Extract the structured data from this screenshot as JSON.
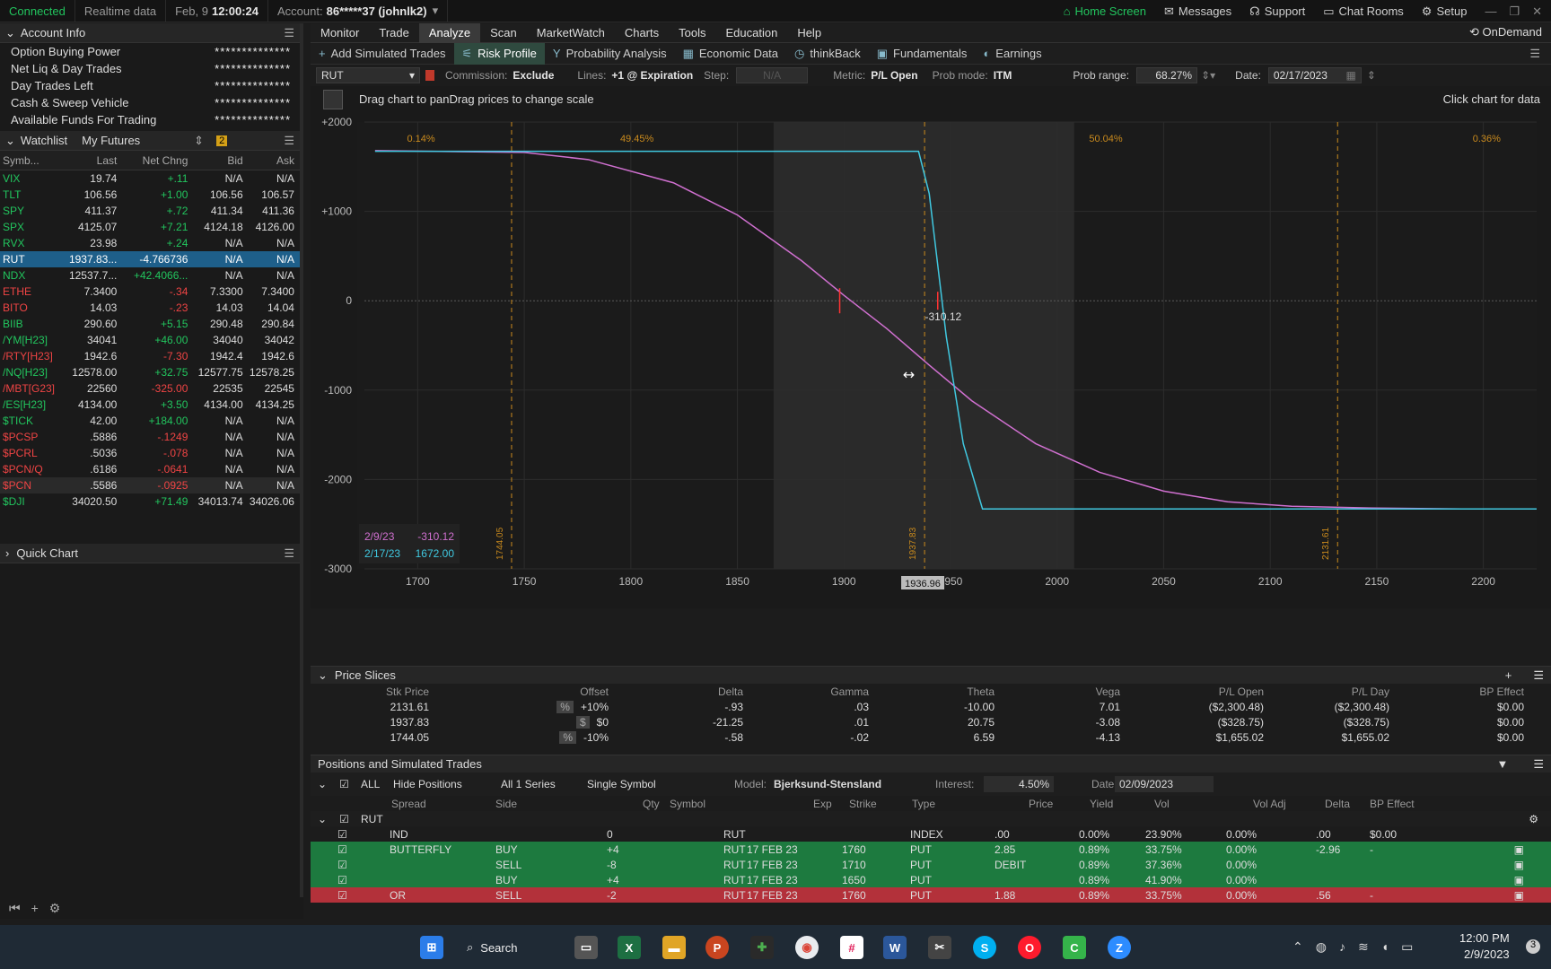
{
  "topbar": {
    "connected": "Connected",
    "realtime": "Realtime data",
    "date": "Feb, 9",
    "time": "12:00:24",
    "account_label": "Account:",
    "account_value": "86*****37 (johnlk2)",
    "home": "Home Screen",
    "messages": "Messages",
    "support": "Support",
    "chat": "Chat Rooms",
    "setup": "Setup"
  },
  "left": {
    "account_info": "Account Info",
    "account_rows": [
      {
        "label": "Option Buying Power",
        "value": "**************"
      },
      {
        "label": "Net Liq & Day Trades",
        "value": "**************"
      },
      {
        "label": "Day Trades Left",
        "value": "**************"
      },
      {
        "label": "Cash & Sweep Vehicle",
        "value": "**************"
      },
      {
        "label": "Available Funds For Trading",
        "value": "**************"
      }
    ],
    "watchlist_title": "Watchlist",
    "watchlist_name": "My Futures",
    "watchlist_badge": "2",
    "wl_cols": [
      "Symb...",
      "Last",
      "Net Chng",
      "Bid",
      "Ask"
    ],
    "wl": [
      {
        "sym": "VIX",
        "last": "19.74",
        "chg": "+.11",
        "bid": "N/A",
        "ask": "N/A",
        "c": "pos"
      },
      {
        "sym": "TLT",
        "last": "106.56",
        "chg": "+1.00",
        "bid": "106.56",
        "ask": "106.57",
        "c": "pos"
      },
      {
        "sym": "SPY",
        "last": "411.37",
        "chg": "+.72",
        "bid": "411.34",
        "ask": "411.36",
        "c": "pos"
      },
      {
        "sym": "SPX",
        "last": "4125.07",
        "chg": "+7.21",
        "bid": "4124.18",
        "ask": "4126.00",
        "c": "pos"
      },
      {
        "sym": "RVX",
        "last": "23.98",
        "chg": "+.24",
        "bid": "N/A",
        "ask": "N/A",
        "c": "pos"
      },
      {
        "sym": "RUT",
        "last": "1937.83...",
        "chg": "-4.766736",
        "bid": "N/A",
        "ask": "N/A",
        "c": "sel"
      },
      {
        "sym": "NDX",
        "last": "12537.7...",
        "chg": "+42.4066...",
        "bid": "N/A",
        "ask": "N/A",
        "c": "pos"
      },
      {
        "sym": "ETHE",
        "last": "7.3400",
        "chg": "-.34",
        "bid": "7.3300",
        "ask": "7.3400",
        "c": "neg"
      },
      {
        "sym": "BITO",
        "last": "14.03",
        "chg": "-.23",
        "bid": "14.03",
        "ask": "14.04",
        "c": "neg"
      },
      {
        "sym": "BIIB",
        "last": "290.60",
        "chg": "+5.15",
        "bid": "290.48",
        "ask": "290.84",
        "c": "pos"
      },
      {
        "sym": "/YM[H23]",
        "last": "34041",
        "chg": "+46.00",
        "bid": "34040",
        "ask": "34042",
        "c": "pos"
      },
      {
        "sym": "/RTY[H23]",
        "last": "1942.6",
        "chg": "-7.30",
        "bid": "1942.4",
        "ask": "1942.6",
        "c": "neg"
      },
      {
        "sym": "/NQ[H23]",
        "last": "12578.00",
        "chg": "+32.75",
        "bid": "12577.75",
        "ask": "12578.25",
        "c": "pos"
      },
      {
        "sym": "/MBT[G23]",
        "last": "22560",
        "chg": "-325.00",
        "bid": "22535",
        "ask": "22545",
        "c": "neg"
      },
      {
        "sym": "/ES[H23]",
        "last": "4134.00",
        "chg": "+3.50",
        "bid": "4134.00",
        "ask": "4134.25",
        "c": "pos"
      },
      {
        "sym": "$TICK",
        "last": "42.00",
        "chg": "+184.00",
        "bid": "N/A",
        "ask": "N/A",
        "c": "pos"
      },
      {
        "sym": "$PCSP",
        "last": ".5886",
        "chg": "-.1249",
        "bid": "N/A",
        "ask": "N/A",
        "c": "neg"
      },
      {
        "sym": "$PCRL",
        "last": ".5036",
        "chg": "-.078",
        "bid": "N/A",
        "ask": "N/A",
        "c": "neg"
      },
      {
        "sym": "$PCN/Q",
        "last": ".6186",
        "chg": "-.0641",
        "bid": "N/A",
        "ask": "N/A",
        "c": "neg"
      },
      {
        "sym": "$PCN",
        "last": ".5586",
        "chg": "-.0925",
        "bid": "N/A",
        "ask": "N/A",
        "c": "neg"
      },
      {
        "sym": "$DJI",
        "last": "34020.50",
        "chg": "+71.49",
        "bid": "34013.74",
        "ask": "34026.06",
        "c": "pos"
      }
    ],
    "quick_chart": "Quick Chart"
  },
  "tabs": [
    "Monitor",
    "Trade",
    "Analyze",
    "Scan",
    "MarketWatch",
    "Charts",
    "Tools",
    "Education",
    "Help"
  ],
  "ondemand": "OnDemand",
  "subtabs": [
    "Add Simulated Trades",
    "Risk Profile",
    "Probability Analysis",
    "Economic Data",
    "thinkBack",
    "Fundamentals",
    "Earnings"
  ],
  "ctrl": {
    "symbol": "RUT",
    "commission_label": "Commission:",
    "commission": "Exclude",
    "lines_label": "Lines:",
    "lines": "+1 @ Expiration",
    "step_label": "Step:",
    "step": "N/A",
    "metric_label": "Metric:",
    "metric": "P/L Open",
    "prob_label": "Prob mode:",
    "prob": "ITM",
    "range_label": "Prob range:",
    "range": "68.27%",
    "date_label": "Date:",
    "date": "02/17/2023"
  },
  "chart_hint": "Drag chart to panDrag prices to change scale",
  "click_hint": "Click chart for data",
  "chart_data": {
    "type": "line",
    "ylabels": [
      "+2000",
      "+1000",
      "0",
      "-1000",
      "-2000",
      "-3000"
    ],
    "yvals": [
      2000,
      1000,
      0,
      -1000,
      -2000,
      -3000
    ],
    "xlabels": [
      "1700",
      "1750",
      "1800",
      "1850",
      "1900",
      "1950",
      "2000",
      "2050",
      "2100",
      "2150",
      "2200"
    ],
    "xvals": [
      1700,
      1750,
      1800,
      1850,
      1900,
      1950,
      2000,
      2050,
      2100,
      2150,
      2200
    ],
    "xlim": [
      1675,
      2225
    ],
    "ylim": [
      -3000,
      2000
    ],
    "prob_labels": [
      "0.14%",
      "49.45%",
      "50.04%",
      "0.36%"
    ],
    "vlines": [
      {
        "x": 1744.05,
        "label": "1744.05"
      },
      {
        "x": 1937.83,
        "label": "1937.83"
      },
      {
        "x": 2131.61,
        "label": "2131.61"
      }
    ],
    "price_marker": "1936.96",
    "point_label": "-310.12",
    "legend": [
      {
        "date": "2/9/23",
        "value": "-310.12",
        "color": "#d070d0"
      },
      {
        "date": "2/17/23",
        "value": "1672.00",
        "color": "#40c8e0"
      }
    ],
    "series": [
      {
        "color": "#d070d0",
        "x": [
          1680,
          1750,
          1780,
          1820,
          1850,
          1880,
          1900,
          1920,
          1940,
          1960,
          1990,
          2020,
          2050,
          2080,
          2110,
          2150,
          2190
        ],
        "y": [
          1680,
          1660,
          1580,
          1320,
          960,
          450,
          60,
          -310,
          -720,
          -1120,
          -1600,
          -1920,
          -2130,
          -2250,
          -2300,
          -2320,
          -2330
        ]
      },
      {
        "color": "#40c8e0",
        "x": [
          1680,
          1935,
          1940,
          1948,
          1956,
          1965,
          2225
        ],
        "y": [
          1672,
          1672,
          1200,
          -400,
          -1600,
          -2330,
          -2330
        ]
      }
    ]
  },
  "price_slices": {
    "title": "Price Slices",
    "cols": [
      "Stk Price",
      "Offset",
      "Delta",
      "Gamma",
      "Theta",
      "Vega",
      "P/L Open",
      "P/L Day",
      "BP Effect"
    ],
    "rows": [
      {
        "stk": "2131.61",
        "unit": "%",
        "off": "+10%",
        "delta": "-.93",
        "gamma": ".03",
        "theta": "-10.00",
        "vega": "7.01",
        "plo": "($2,300.48)",
        "pld": "($2,300.48)",
        "bp": "$0.00"
      },
      {
        "stk": "1937.83",
        "unit": "$",
        "off": "$0",
        "delta": "-21.25",
        "gamma": ".01",
        "theta": "20.75",
        "vega": "-3.08",
        "plo": "($328.75)",
        "pld": "($328.75)",
        "bp": "$0.00"
      },
      {
        "stk": "1744.05",
        "unit": "%",
        "off": "-10%",
        "delta": "-.58",
        "gamma": "-.02",
        "theta": "6.59",
        "vega": "-4.13",
        "plo": "$1,655.02",
        "pld": "$1,655.02",
        "bp": "$0.00"
      }
    ]
  },
  "positions": {
    "title": "Positions and Simulated Trades",
    "all": "ALL",
    "hide": "Hide Positions",
    "series": "All 1 Series",
    "single": "Single Symbol",
    "model_label": "Model:",
    "model": "Bjerksund-Stensland",
    "interest_label": "Interest:",
    "interest": "4.50%",
    "date_label": "Date:",
    "date": "02/09/2023",
    "cols": [
      "Spread",
      "Side",
      "Qty",
      "Symbol",
      "Exp",
      "Strike",
      "Type",
      "Price",
      "Yield",
      "Vol",
      "Vol Adj",
      "Delta",
      "BP Effect"
    ],
    "group": "RUT",
    "rows": [
      {
        "spread": "IND",
        "side": "",
        "qty": "0",
        "sym": "RUT",
        "exp": "",
        "strike": "",
        "type": "INDEX",
        "price": ".00",
        "yield": "0.00%",
        "vol": "23.90%",
        "voladj": "0.00%",
        "delta": ".00",
        "bp": "$0.00",
        "cls": ""
      },
      {
        "spread": "BUTTERFLY",
        "side": "BUY",
        "qty": "+4",
        "sym": "RUT",
        "exp": "17 FEB 23",
        "strike": "1760",
        "type": "PUT",
        "price": "2.85",
        "yield": "0.89%",
        "vol": "33.75%",
        "voladj": "0.00%",
        "delta": "-2.96",
        "bp": "-",
        "cls": "g"
      },
      {
        "spread": "",
        "side": "SELL",
        "qty": "-8",
        "sym": "RUT",
        "exp": "17 FEB 23",
        "strike": "1710",
        "type": "PUT",
        "price": "DEBIT",
        "yield": "0.89%",
        "vol": "37.36%",
        "voladj": "0.00%",
        "delta": "",
        "bp": "",
        "cls": "g"
      },
      {
        "spread": "",
        "side": "BUY",
        "qty": "+4",
        "sym": "RUT",
        "exp": "17 FEB 23",
        "strike": "1650",
        "type": "PUT",
        "price": "",
        "yield": "0.89%",
        "vol": "41.90%",
        "voladj": "0.00%",
        "delta": "",
        "bp": "",
        "cls": "g"
      },
      {
        "spread": "OR",
        "side": "SELL",
        "qty": "-2",
        "sym": "RUT",
        "exp": "17 FEB 23",
        "strike": "1760",
        "type": "PUT",
        "price": "1.88",
        "yield": "0.89%",
        "vol": "33.75%",
        "voladj": "0.00%",
        "delta": ".56",
        "bp": "-",
        "cls": "r"
      }
    ]
  },
  "taskbar": {
    "search": "Search",
    "time": "12:00 PM",
    "date": "2/9/2023",
    "badge": "3"
  }
}
